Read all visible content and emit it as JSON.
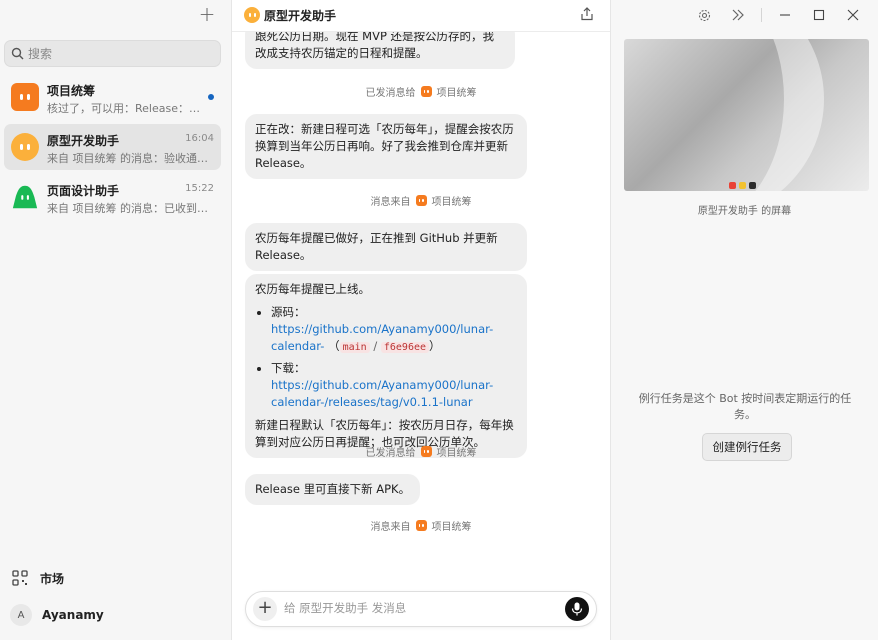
{
  "sidebar": {
    "search_placeholder": "搜索",
    "chats": [
      {
        "title": "项目统筹",
        "time": "",
        "preview": "核过了，可以用：Release：…",
        "unread": true
      },
      {
        "title": "原型开发助手",
        "time": "16:04",
        "preview": "来自 项目统筹 的消息：验收通…",
        "unread": false
      },
      {
        "title": "页面设计助手",
        "time": "15:22",
        "preview": "来自 项目统筹 的消息：已收到…",
        "unread": false
      }
    ],
    "market_label": "市场",
    "user": {
      "initial": "A",
      "name": "Ayanamy"
    }
  },
  "chat": {
    "title": "原型开发助手",
    "messages": {
      "m1": "跟死公历日期。现在 MVP 还是按公历存的，我改成支持农历锚定的日程和提醒。",
      "s1": {
        "label": "已发消息给",
        "target": "项目统筹"
      },
      "m2": "正在改：新建日程可选「农历每年」，提醒会按农历换算到当年公历日再响。好了我会推到仓库并更新 Release。",
      "s2": {
        "label": "消息来自",
        "target": "项目统筹"
      },
      "m3": "农历每年提醒已做好，正在推到 GitHub 并更新 Release。",
      "m4": {
        "intro": "农历每年提醒已上线。",
        "source_label": "源码：",
        "source_url": "https://github.com/Ayanamy000/lunar-calendar-",
        "branch_open": "（",
        "branch": "main",
        "slash": "/",
        "commit": "f6e96ee",
        "branch_close": "）",
        "download_label": "下载：",
        "download_url": "https://github.com/Ayanamy000/lunar-calendar-/releases/tag/v0.1.1-lunar",
        "footer": "新建日程默认「农历每年」：按农历月日存，每年换算到对应公历日再提醒；也可改回公历单次。"
      },
      "s3": {
        "label": "已发消息给",
        "target": "项目统筹"
      },
      "m5": "Release 里可直接下新 APK。",
      "s4": {
        "label": "消息来自",
        "target": "项目统筹"
      }
    },
    "composer_placeholder": "给 原型开发助手 发消息"
  },
  "right": {
    "screen_caption": "原型开发助手 的屏幕",
    "routine_desc": "例行任务是这个 Bot 按时间表定期运行的任务。",
    "routine_button": "创建例行任务"
  },
  "colors": {
    "accent_orange": "#f57b1f",
    "accent_yellow": "#fbb03b",
    "link": "#1a73c9",
    "unread": "#1565c0"
  }
}
